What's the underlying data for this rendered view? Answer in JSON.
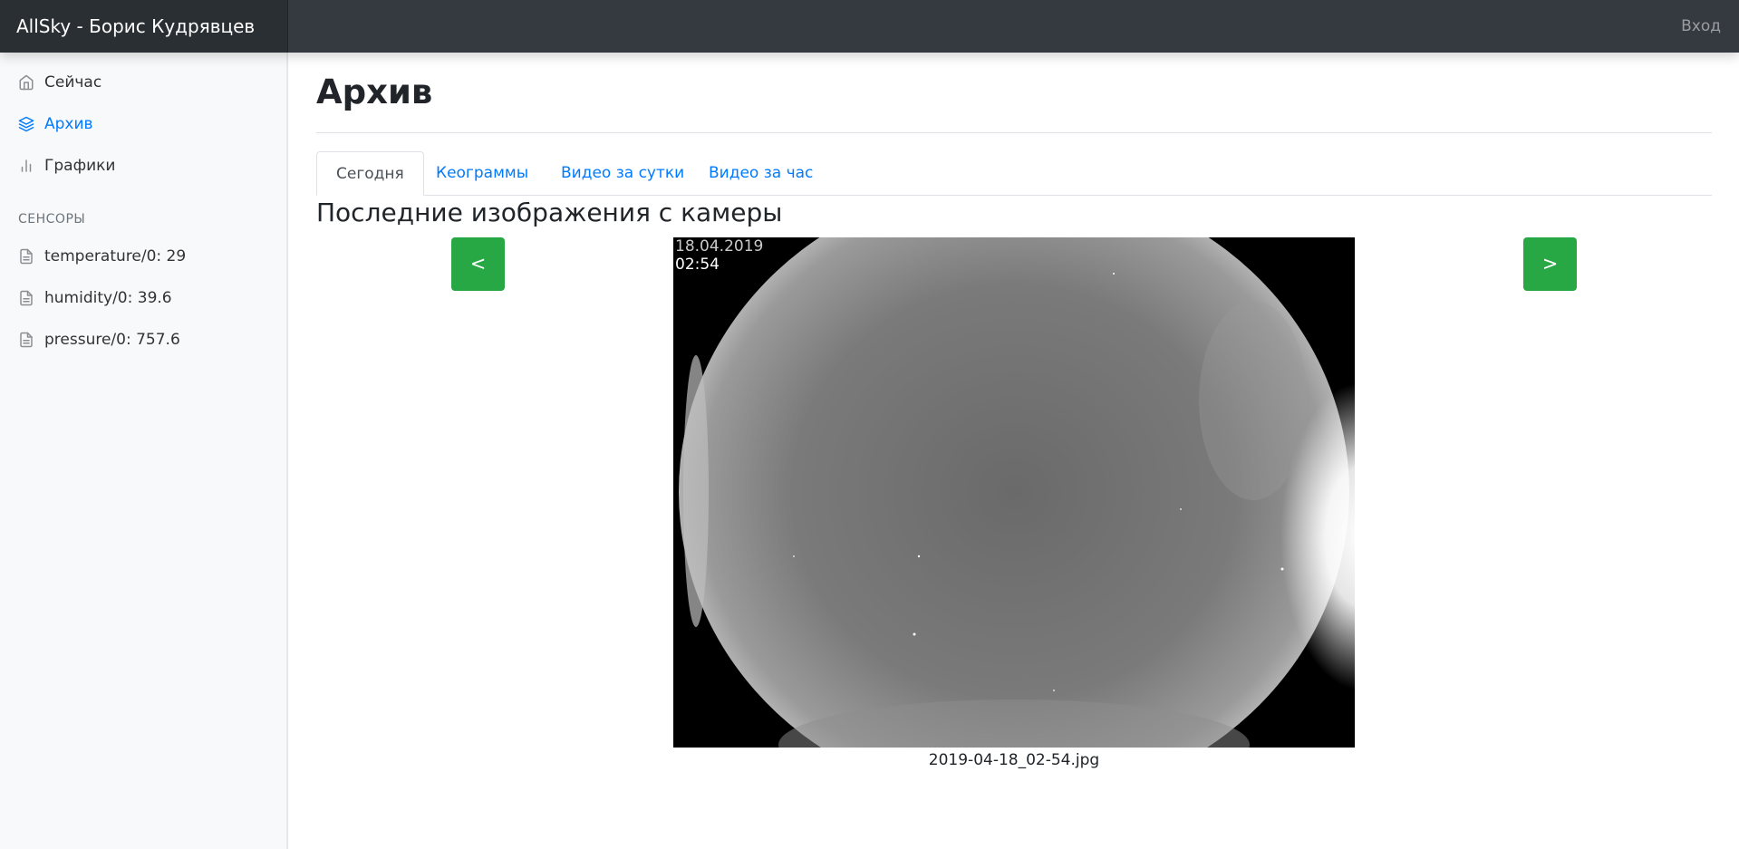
{
  "navbar": {
    "brand": "AllSky - Борис Кудрявцев",
    "signin": "Вход"
  },
  "sidebar": {
    "items": [
      {
        "label": "Сейчас",
        "icon": "home-icon"
      },
      {
        "label": "Архив",
        "icon": "layers-icon",
        "active": true
      },
      {
        "label": "Графики",
        "icon": "bar-chart-icon"
      }
    ],
    "sensors_heading": "СЕНСОРЫ",
    "sensors": [
      {
        "label": "temperature/0: 29",
        "icon": "file-text-icon"
      },
      {
        "label": "humidity/0: 39.6",
        "icon": "file-text-icon"
      },
      {
        "label": "pressure/0: 757.6",
        "icon": "file-text-icon"
      }
    ]
  },
  "main": {
    "title": "Архив",
    "tabs": [
      {
        "label": "Сегодня",
        "active": true
      },
      {
        "label": "Кеограммы"
      },
      {
        "label": "Видео за сутки"
      },
      {
        "label": "Видео за час"
      }
    ],
    "section_title": "Последние изображения с камеры",
    "prev_button": "<",
    "next_button": ">",
    "image": {
      "date_stamp": "18.04.2019",
      "time_stamp": "02:54",
      "caption": "2019-04-18_02-54.jpg"
    }
  },
  "colors": {
    "navbar": "#343a40",
    "accent": "#007bff",
    "button": "#28a745",
    "sidebar_bg": "#f8f9fa"
  }
}
